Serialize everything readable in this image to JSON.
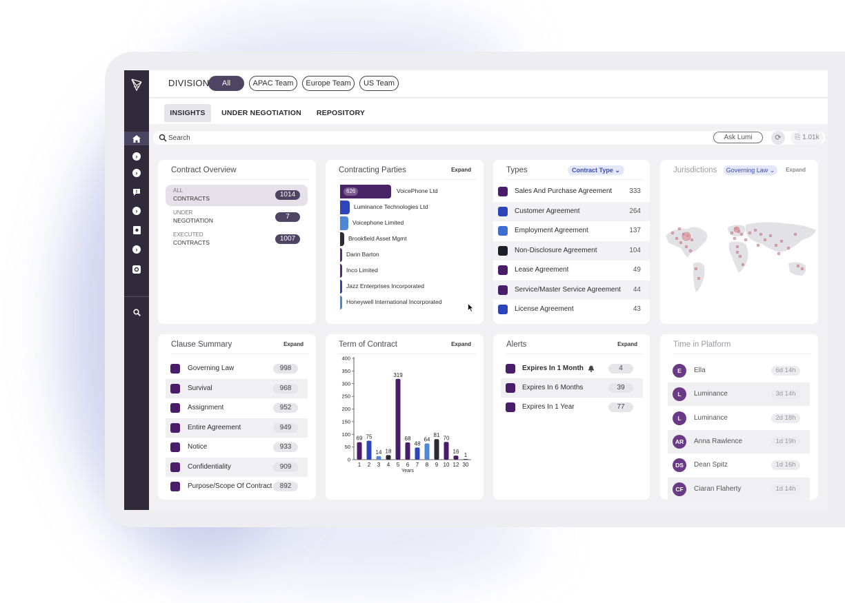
{
  "division": {
    "label": "DIVISION",
    "chips": [
      "All",
      "APAC Team",
      "Europe Team",
      "US Team"
    ]
  },
  "tabs": [
    "INSIGHTS",
    "UNDER NEGOTIATION",
    "REPOSITORY"
  ],
  "search": {
    "placeholder": "Search",
    "ask_label": "Ask Lumi",
    "count": "1.01k"
  },
  "overview": {
    "title": "Contract Overview",
    "rows": [
      {
        "l1": "ALL",
        "l2": "CONTRACTS",
        "value": "1014"
      },
      {
        "l1": "UNDER",
        "l2": "NEGOTIATION",
        "value": "7"
      },
      {
        "l1": "EXECUTED",
        "l2": "CONTRACTS",
        "value": "1007"
      }
    ]
  },
  "parties": {
    "title": "Contracting Parties",
    "expand": "Expand",
    "items": [
      {
        "name": "VoicePhone Ltd",
        "count": "626",
        "value": 626,
        "color": "#4a2466"
      },
      {
        "name": "Luminance Technologies Ltd",
        "value": 120,
        "color": "#2d45b8"
      },
      {
        "name": "Voicephone Limited",
        "value": 100,
        "color": "#4f87d8"
      },
      {
        "name": "Brookfield Asset Mgmt",
        "value": 50,
        "color": "#2b2b36"
      },
      {
        "name": "Darin Barton",
        "value": 20,
        "color": "#5a2a7a"
      },
      {
        "name": "Inco Limited",
        "value": 20,
        "color": "#5a2a7a"
      },
      {
        "name": "Jazz Enterprises Incorporated",
        "value": 20,
        "color": "#2d45b8"
      },
      {
        "name": "Honeywell International Incorporated",
        "value": 20,
        "color": "#4f87d8"
      }
    ]
  },
  "types": {
    "title": "Types",
    "filter": "Contract Type",
    "items": [
      {
        "name": "Sales And Purchase Agreement",
        "count": "333",
        "color": "#4a1d6b"
      },
      {
        "name": "Customer Agreement",
        "count": "264",
        "color": "#2d45b8"
      },
      {
        "name": "Employment Agreement",
        "count": "137",
        "color": "#3e6fd0"
      },
      {
        "name": "Non-Disclosure Agreement",
        "count": "104",
        "color": "#1e1e2a"
      },
      {
        "name": "Lease Agreement",
        "count": "49",
        "color": "#4a1d6b"
      },
      {
        "name": "Service/Master Service Agreement",
        "count": "44",
        "color": "#4a1d6b"
      },
      {
        "name": "License Agreement",
        "count": "43",
        "color": "#2d45b8"
      }
    ]
  },
  "jurisdictions": {
    "title": "Jurisdictions",
    "filter": "Governing Law",
    "expand": "Expand"
  },
  "clauses": {
    "title": "Clause Summary",
    "expand": "Expand",
    "items": [
      {
        "name": "Governing Law",
        "count": "998"
      },
      {
        "name": "Survival",
        "count": "968"
      },
      {
        "name": "Assignment",
        "count": "952"
      },
      {
        "name": "Entire Agreement",
        "count": "949"
      },
      {
        "name": "Notice",
        "count": "933"
      },
      {
        "name": "Confidentiality",
        "count": "909"
      },
      {
        "name": "Purpose/Scope Of Contract",
        "count": "892"
      }
    ]
  },
  "term": {
    "title": "Term of Contract",
    "expand": "Expand"
  },
  "chart_data": {
    "type": "bar",
    "xlabel": "Years",
    "ylabel": "",
    "ylim": [
      0,
      400
    ],
    "yticks": [
      "0",
      "50",
      "100",
      "150",
      "200",
      "250",
      "300",
      "350",
      "400"
    ],
    "categories": [
      "1",
      "2",
      "3",
      "4",
      "5",
      "6",
      "7",
      "8",
      "9",
      "10",
      "12",
      "30"
    ],
    "values": [
      69,
      75,
      14,
      18,
      319,
      68,
      48,
      64,
      81,
      70,
      16,
      1
    ],
    "colors": [
      "#4a1d6b",
      "#2d45b8",
      "#4f87d8",
      "#2b2b36",
      "#4a1d6b",
      "#4a1d6b",
      "#2d45b8",
      "#4f87d8",
      "#2b2b36",
      "#4a1d6b",
      "#4a1d6b",
      "#4a1d6b"
    ],
    "grid": false
  },
  "alerts": {
    "title": "Alerts",
    "expand": "Expand",
    "items": [
      {
        "name": "Expires In 1 Month",
        "count": "4"
      },
      {
        "name": "Expires In 6 Months",
        "count": "39"
      },
      {
        "name": "Expires In 1 Year",
        "count": "77"
      }
    ]
  },
  "platform": {
    "title": "Time in Platform",
    "items": [
      {
        "initials": "E",
        "name": "Ella",
        "time": "6d 14h"
      },
      {
        "initials": "L",
        "name": "Luminance",
        "time": "3d 14h"
      },
      {
        "initials": "L",
        "name": "Luminance",
        "time": "2d 18h"
      },
      {
        "initials": "AR",
        "name": "Anna Rawlence",
        "time": "1d 19h"
      },
      {
        "initials": "DS",
        "name": "Dean Spitz",
        "time": "1d 16h"
      },
      {
        "initials": "CF",
        "name": "Ciaran Flaherty",
        "time": "1d 14h"
      }
    ]
  }
}
